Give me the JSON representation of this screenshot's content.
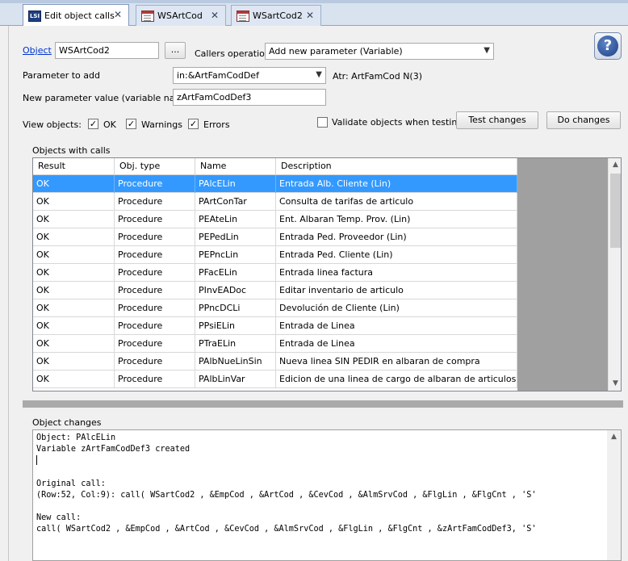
{
  "tabs": [
    {
      "label": "Edit object calls",
      "icon": "lsi-icon",
      "icon_text": "LSI",
      "active": true
    },
    {
      "label": "WSArtCod",
      "icon": "window-icon",
      "active": false
    },
    {
      "label": "WSartCod2",
      "icon": "window-icon",
      "active": false
    }
  ],
  "form": {
    "object_link": "Object",
    "object_value": "WSArtCod2",
    "browse_label": "...",
    "callers_operation_label": "Callers operation",
    "callers_operation_value": "Add new parameter (Variable)",
    "parameter_to_add_label": "Parameter to add",
    "parameter_to_add_value": "in:&ArtFamCodDef",
    "atr_text": "Atr: ArtFamCod N(3)",
    "new_param_label": "New parameter value (variable name)",
    "new_param_value": "zArtFamCodDef3",
    "view_objects_label": "View objects:",
    "cb_ok_label": "OK",
    "cb_warnings_label": "Warnings",
    "cb_errors_label": "Errors",
    "cb_ok_checked": true,
    "cb_warnings_checked": true,
    "cb_errors_checked": true,
    "validate_label": "Validate objects when testing",
    "validate_checked": false,
    "test_changes_label": "Test changes",
    "do_changes_label": "Do changes",
    "help_symbol": "?",
    "check_mark": "✓"
  },
  "objects_with_calls": {
    "title": "Objects with calls",
    "columns": [
      "Result",
      "Obj. type",
      "Name",
      "Description"
    ],
    "rows": [
      [
        "OK",
        "Procedure",
        "PAlcELin",
        "Entrada Alb. Cliente (Lin)"
      ],
      [
        "OK",
        "Procedure",
        "PArtConTar",
        "Consulta de tarifas de articulo"
      ],
      [
        "OK",
        "Procedure",
        "PEAteLin",
        "Ent. Albaran Temp. Prov. (Lin)"
      ],
      [
        "OK",
        "Procedure",
        "PEPedLin",
        "Entrada Ped. Proveedor (Lin)"
      ],
      [
        "OK",
        "Procedure",
        "PEPncLin",
        "Entrada Ped. Cliente (Lin)"
      ],
      [
        "OK",
        "Procedure",
        "PFacELin",
        "Entrada linea factura"
      ],
      [
        "OK",
        "Procedure",
        "PInvEADoc",
        "Editar inventario de articulo"
      ],
      [
        "OK",
        "Procedure",
        "PPncDCLi",
        "Devolución de Cliente (Lin)"
      ],
      [
        "OK",
        "Procedure",
        "PPsiELin",
        "Entrada de Linea"
      ],
      [
        "OK",
        "Procedure",
        "PTraELin",
        "Entrada de Linea"
      ],
      [
        "OK",
        "Procedure",
        "PAlbNueLinSin",
        "Nueva linea SIN PEDIR en albaran de compra"
      ],
      [
        "OK",
        "Procedure",
        "PAlbLinVar",
        "Edicion de una linea de cargo de albaran de articulos varios"
      ]
    ],
    "selected_row": 0
  },
  "object_changes": {
    "title": "Object changes",
    "line1": "Object: PAlcELin",
    "line2": "Variable zArtFamCodDef3 created",
    "line4": "Original call:",
    "line5": "(Row:52, Col:9): call( WSartCod2 , &EmpCod , &ArtCod , &CevCod , &AlmSrvCod , &FlgLin , &FlgCnt , 'S'",
    "line7": "New call:",
    "line8": "call( WSartCod2 , &EmpCod , &ArtCod , &CevCod , &AlmSrvCod , &FlgLin , &FlgCnt , &zArtFamCodDef3, 'S'"
  }
}
